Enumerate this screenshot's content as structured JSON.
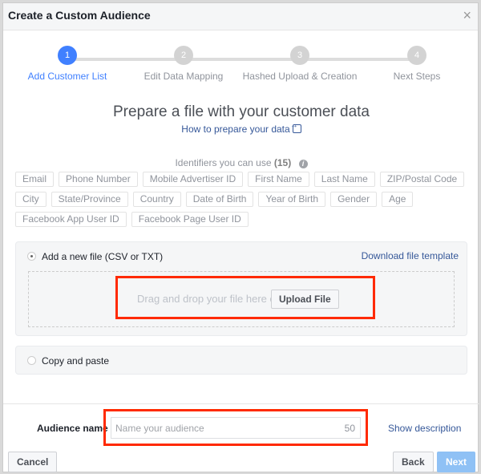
{
  "dialog": {
    "title": "Create a Custom Audience",
    "close_icon": "close-icon"
  },
  "steps": [
    {
      "number": "1",
      "label": "Add Customer List",
      "active": true
    },
    {
      "number": "2",
      "label": "Edit Data Mapping",
      "active": false
    },
    {
      "number": "3",
      "label": "Hashed Upload & Creation",
      "active": false
    },
    {
      "number": "4",
      "label": "Next Steps",
      "active": false
    }
  ],
  "main": {
    "title": "Prepare a file with your customer data",
    "howto_link": "How to prepare your data",
    "identifiers_label": "Identifiers you can use",
    "identifiers_count": "(15)",
    "identifier_rows": [
      [
        "Email",
        "Phone Number",
        "Mobile Advertiser ID",
        "First Name",
        "Last Name",
        "ZIP/Postal Code"
      ],
      [
        "City",
        "State/Province",
        "Country",
        "Date of Birth",
        "Year of Birth",
        "Gender",
        "Age"
      ],
      [
        "Facebook App User ID",
        "Facebook Page User ID"
      ]
    ]
  },
  "upload_option": {
    "label": "Add a new file (CSV or TXT)",
    "selected": true,
    "download_link": "Download file template",
    "drop_text": "Drag and drop your file here or",
    "upload_button": "Upload File"
  },
  "paste_option": {
    "label": "Copy and paste",
    "selected": false
  },
  "footer": {
    "audience_name_label": "Audience name",
    "audience_name_placeholder": "Name your audience",
    "audience_name_value": "",
    "char_count": "50",
    "show_description": "Show description",
    "cancel": "Cancel",
    "back": "Back",
    "next": "Next"
  },
  "colors": {
    "accent": "#4080ff",
    "link": "#365899",
    "highlight": "#ff2a00",
    "next_disabled": "#8fc1f5"
  }
}
